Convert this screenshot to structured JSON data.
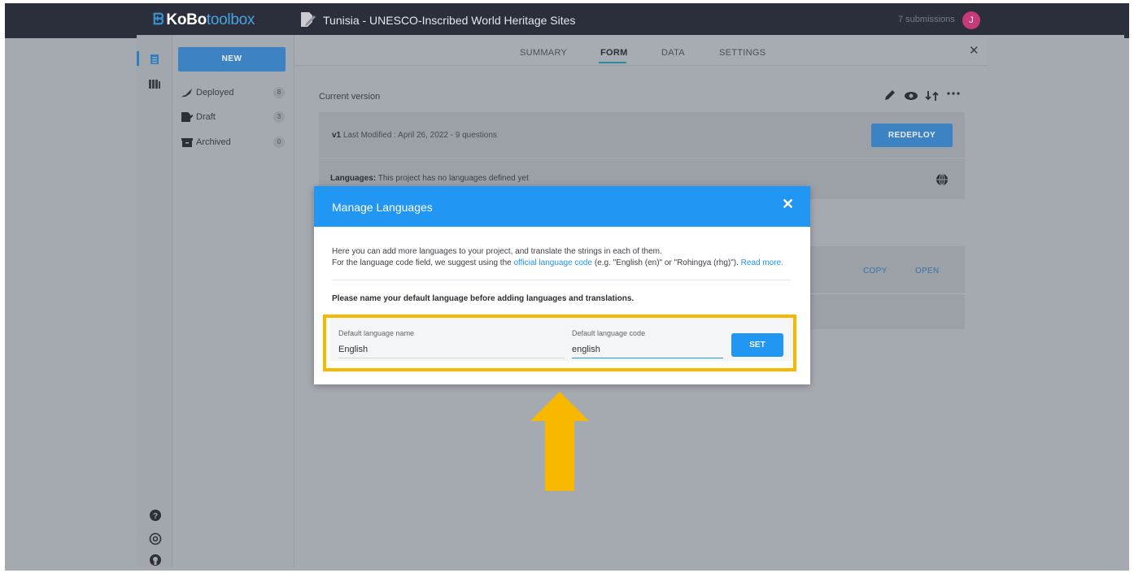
{
  "app": {
    "logo_mark": "ᗸ",
    "logo_part1": "KoBo",
    "logo_part2": "toolbox",
    "project_title": "Tunisia - UNESCO-Inscribed World Heritage Sites",
    "submissions": "7 submissions",
    "avatar_letter": "J"
  },
  "sidebar": {
    "new_label": "NEW",
    "items": [
      {
        "label": "Deployed",
        "count": "8",
        "icon": "rocket-icon"
      },
      {
        "label": "Draft",
        "count": "3",
        "icon": "draft-icon"
      },
      {
        "label": "Archived",
        "count": "0",
        "icon": "archive-icon"
      }
    ]
  },
  "tabs": [
    "SUMMARY",
    "FORM",
    "DATA",
    "SETTINGS"
  ],
  "active_tab": "FORM",
  "form": {
    "current_version_label": "Current version",
    "version": "v1",
    "version_meta": "Last Modified : April 26, 2022 - 9 questions",
    "redeploy_label": "REDEPLOY",
    "languages_label": "Languages:",
    "languages_text": "This project has no languages defined yet",
    "copy_label": "COPY",
    "open_label": "OPEN"
  },
  "modal": {
    "title": "Manage Languages",
    "close": "✕",
    "intro_line1": "Here you can add more languages to your project, and translate the strings in each of them.",
    "intro_line2_a": "For the language code field, we suggest using the ",
    "intro_link": "official language code",
    "intro_line2_b": " (e.g. \"English (en)\" or \"Rohingya (rhg)\"). ",
    "read_more": "Read more.",
    "note": "Please name your default language before adding languages and translations.",
    "name_label": "Default language name",
    "name_value": "English",
    "code_label": "Default language code",
    "code_value": "english",
    "set_label": "SET"
  },
  "colors": {
    "accent": "#2196f3",
    "highlight": "#f8b800",
    "topbar": "#2a2f3b",
    "avatar": "#c53b7a"
  }
}
